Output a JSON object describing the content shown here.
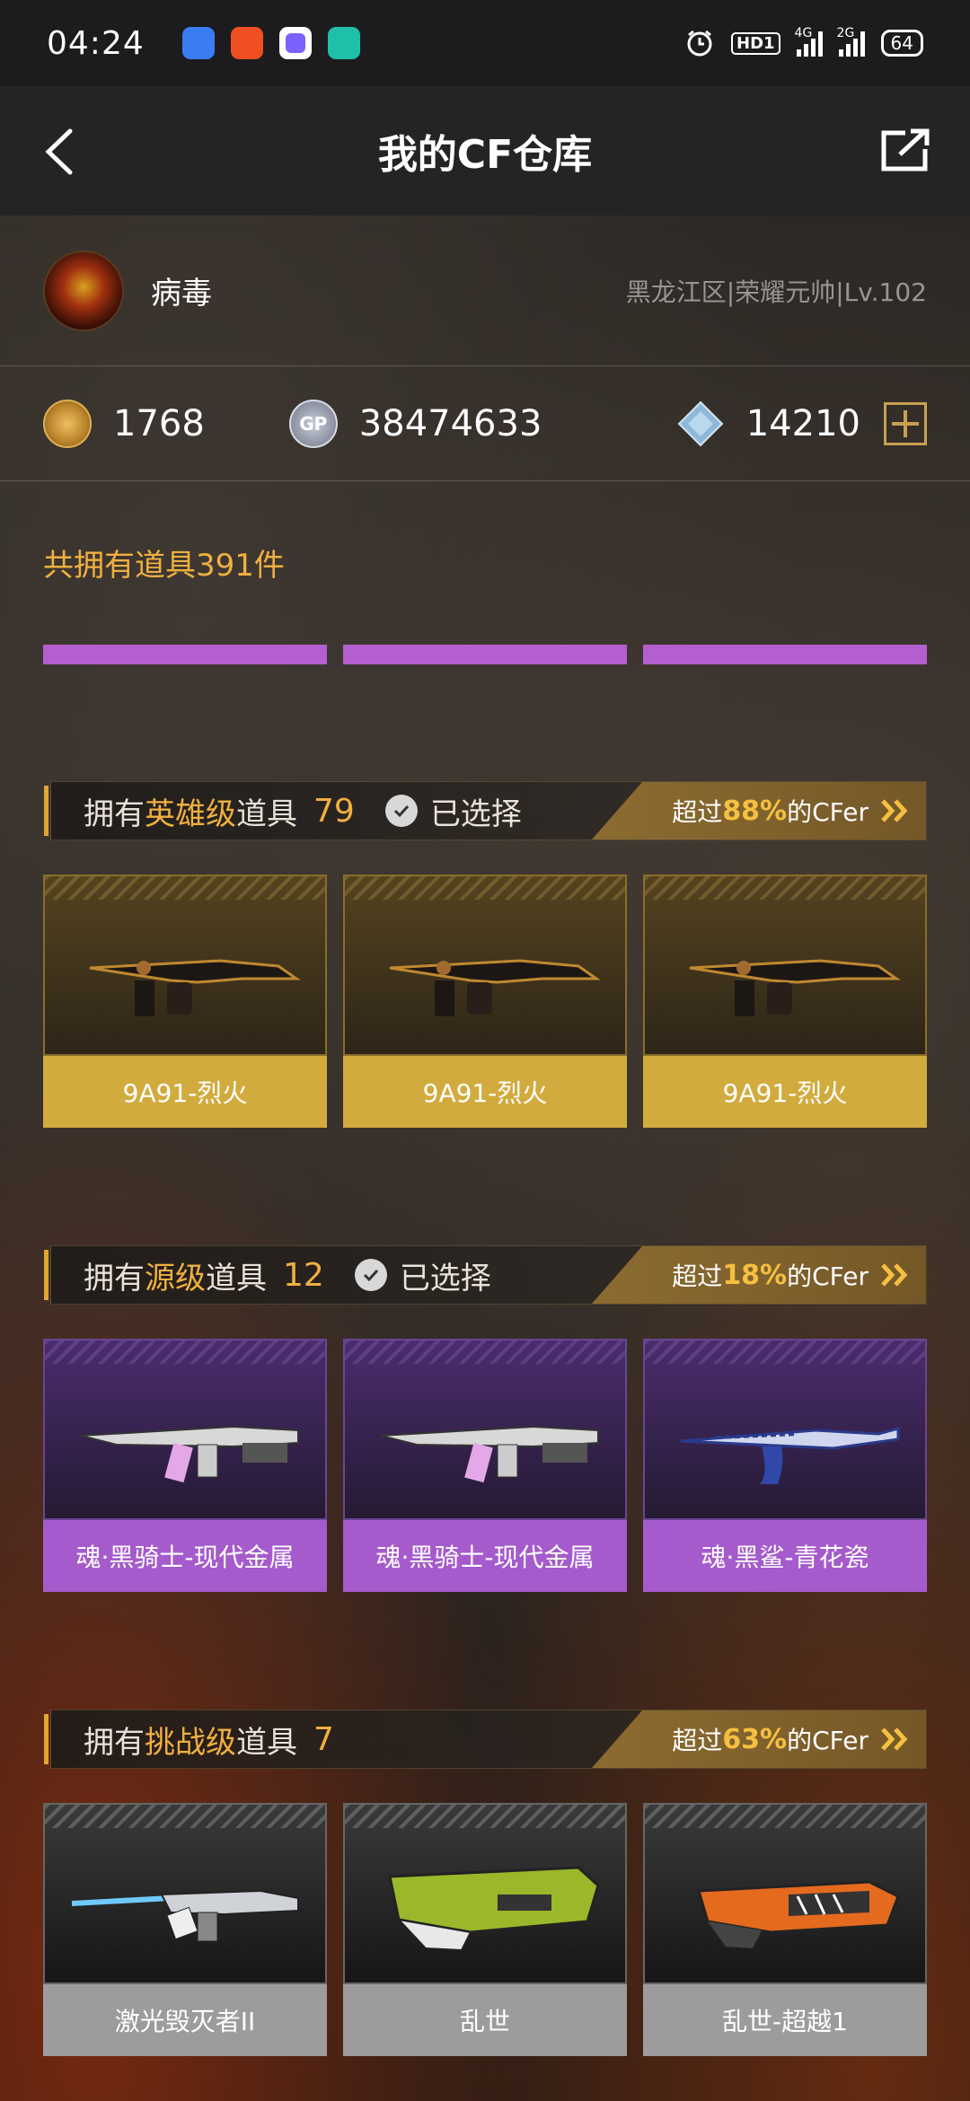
{
  "status_bar": {
    "time": "04:24",
    "hd_label": "HD1",
    "signal1_label": "4G",
    "signal2_label": "2G",
    "battery": "64",
    "app_icon_colors": [
      "#3b7cf5",
      "#f04e23",
      "#7b61ff",
      "#1fbfa8"
    ]
  },
  "header": {
    "title": "我的CF仓库",
    "back_icon": "chevron-left-icon",
    "share_icon": "share-external-icon"
  },
  "profile": {
    "nickname": "病毒",
    "rank_info": "黑龙江区|荣耀元帅|Lv.102"
  },
  "currencies": {
    "cf_points": "1768",
    "gp_label": "GP",
    "gp": "38474633",
    "diamonds": "14210",
    "add_icon": "plus-icon"
  },
  "inventory": {
    "total_text": "共拥有道具391件"
  },
  "colors": {
    "accent_gold": "#f0b040",
    "hero_name_bg": "#d2ab3f",
    "source_name_bg": "#a55bcc",
    "challenge_name_bg": "#9c9c9c",
    "purple_bar": "#b35fd0"
  },
  "sections": [
    {
      "prefix": "拥有",
      "grade": "英雄级",
      "suffix": "道具",
      "count": "79",
      "selected_label": "已选择",
      "rank_prefix": "超过",
      "rank_pct": "88%",
      "rank_suffix": "的CFer",
      "items": [
        {
          "name": "9A91-烈火"
        },
        {
          "name": "9A91-烈火"
        },
        {
          "name": "9A91-烈火"
        }
      ]
    },
    {
      "prefix": "拥有",
      "grade": "源级",
      "suffix": "道具",
      "count": "12",
      "selected_label": "已选择",
      "rank_prefix": "超过",
      "rank_pct": "18%",
      "rank_suffix": "的CFer",
      "items": [
        {
          "name": "魂·黑骑士-现代金属"
        },
        {
          "name": "魂·黑骑士-现代金属"
        },
        {
          "name": "魂·黑鲨-青花瓷"
        }
      ]
    },
    {
      "prefix": "拥有",
      "grade": "挑战级",
      "suffix": "道具",
      "count": "7",
      "rank_prefix": "超过",
      "rank_pct": "63%",
      "rank_suffix": "的CFer",
      "items": [
        {
          "name": "激光毁灭者II"
        },
        {
          "name": "乱世"
        },
        {
          "name": "乱世-超越1"
        }
      ]
    }
  ]
}
